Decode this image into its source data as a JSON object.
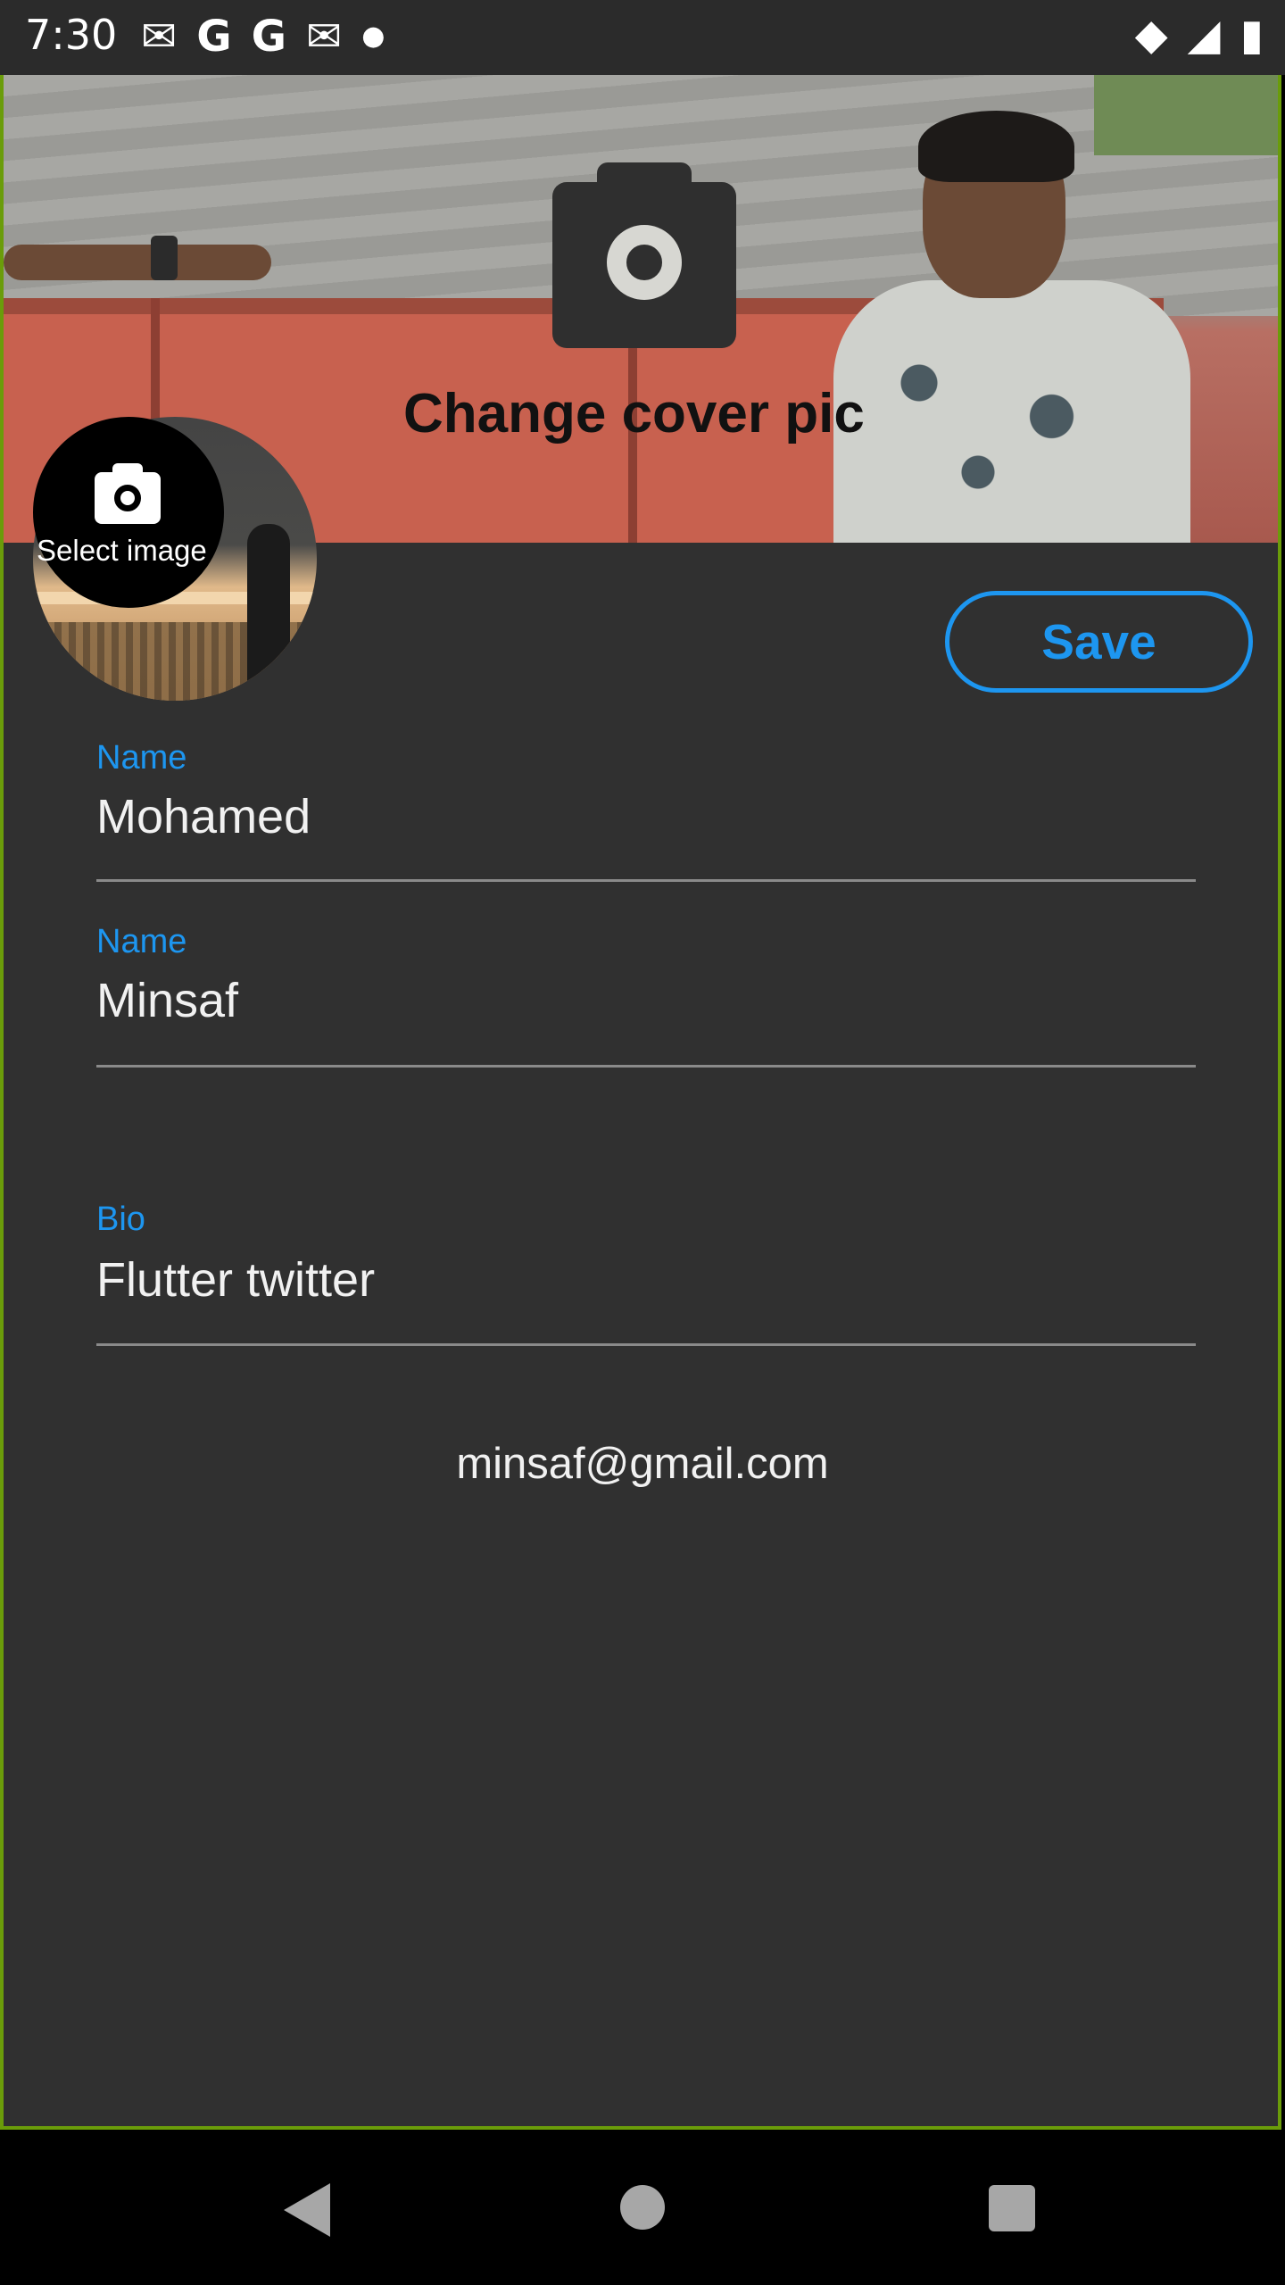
{
  "status_bar": {
    "time": "7:30",
    "left_icons": [
      "gmail-icon",
      "google-icon",
      "google-icon",
      "gmail-icon",
      "dot-icon"
    ],
    "right_icons": [
      "wifi-icon",
      "signal-icon",
      "battery-icon"
    ]
  },
  "cover": {
    "action_label": "Change cover pic",
    "icon": "camera-icon"
  },
  "avatar": {
    "select_label": "Select image",
    "icon": "camera-icon"
  },
  "actions": {
    "save_label": "Save"
  },
  "form": {
    "first_name": {
      "label": "Name",
      "value": "Mohamed"
    },
    "last_name": {
      "label": "Name",
      "value": "Minsaf"
    },
    "bio": {
      "label": "Bio",
      "value": " Flutter twitter"
    },
    "email": "minsaf@gmail.com"
  },
  "colors": {
    "accent": "#1d96f0",
    "background": "#303030",
    "status_bar": "#2b2b2b",
    "nav_bar": "#000000"
  },
  "navigation": {
    "back": "back-icon",
    "home": "home-icon",
    "recents": "recents-icon"
  }
}
